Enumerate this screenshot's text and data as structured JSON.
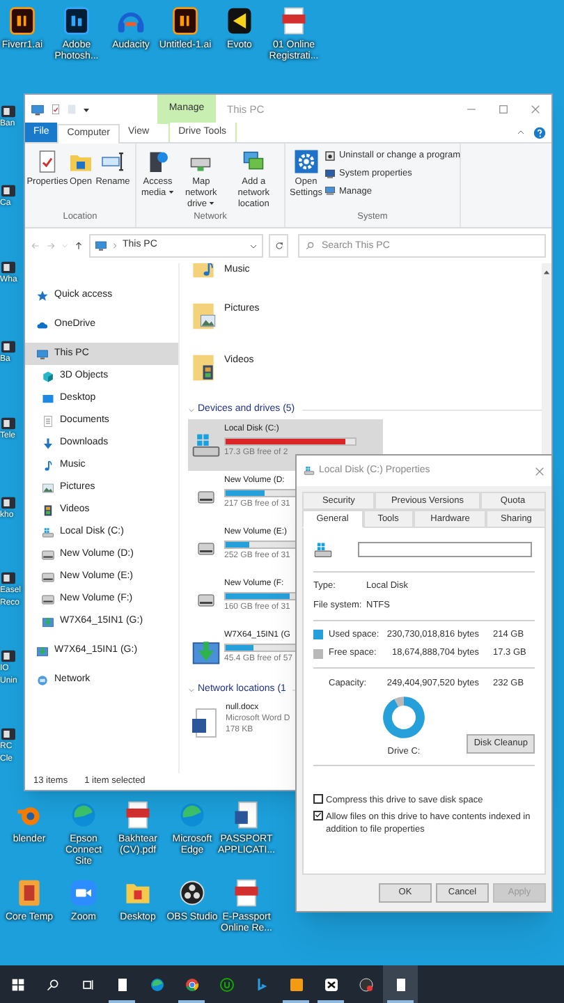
{
  "desktop": {
    "top_row": [
      {
        "label": "Fiverr1.ai",
        "kind": "ai"
      },
      {
        "label": "Adobe Photosh...",
        "kind": "ps"
      },
      {
        "label": "Audacity",
        "kind": "audacity"
      },
      {
        "label": "Untitled-1.ai",
        "kind": "ai"
      },
      {
        "label": "Evoto",
        "kind": "evoto"
      },
      {
        "label": "01 Online Registrati...",
        "kind": "pdf"
      }
    ],
    "left_edge": [
      {
        "label": "Ban"
      },
      {
        "label": "Ca"
      },
      {
        "label": "Wha"
      },
      {
        "label": "Ba"
      },
      {
        "label": "Tele"
      },
      {
        "label": "kho"
      },
      {
        "label": "Easel Reco"
      },
      {
        "label": "IO Unin"
      },
      {
        "label": "RC Cle"
      }
    ],
    "bottom_rows": [
      [
        {
          "label": "blender",
          "kind": "blender"
        },
        {
          "label": "Epson Connect Site",
          "kind": "edge"
        },
        {
          "label": "Bakhtear (CV).pdf",
          "kind": "pdf"
        },
        {
          "label": "Microsoft Edge",
          "kind": "edge"
        },
        {
          "label": "PASSPORT APPLICATI...",
          "kind": "word"
        }
      ],
      [
        {
          "label": "Core Temp",
          "kind": "coretemp"
        },
        {
          "label": "Zoom",
          "kind": "zoom"
        },
        {
          "label": "Desktop",
          "kind": "folder"
        },
        {
          "label": "OBS Studio",
          "kind": "obs"
        },
        {
          "label": "E-Passport Online Re...",
          "kind": "pdf"
        }
      ]
    ]
  },
  "explorer": {
    "title": "This PC",
    "context_tab": "Manage",
    "tabs": [
      {
        "label": "File",
        "kind": "file",
        "selected": false
      },
      {
        "label": "Computer",
        "kind": "tab",
        "selected": true
      },
      {
        "label": "View",
        "kind": "tab",
        "selected": false
      },
      {
        "label": "Drive Tools",
        "kind": "context",
        "selected": false
      }
    ],
    "ribbon": [
      {
        "label": "Location",
        "buttons": [
          {
            "label": "Properties",
            "kind": "properties",
            "dropdown": false
          },
          {
            "label": "Open",
            "kind": "open",
            "dropdown": false
          },
          {
            "label": "Rename",
            "kind": "rename",
            "dropdown": false
          }
        ]
      },
      {
        "label": "Network",
        "buttons": [
          {
            "label": "Access media",
            "kind": "media",
            "dropdown": true
          },
          {
            "label": "Map network drive",
            "kind": "map-drive",
            "dropdown": true
          },
          {
            "label": "Add a network location",
            "kind": "network-location",
            "dropdown": false
          }
        ]
      },
      {
        "label": "System",
        "buttons": [
          {
            "label": "Open Settings",
            "kind": "settings",
            "dropdown": false
          }
        ],
        "small_buttons": [
          {
            "label": "Uninstall or change a program",
            "kind": "uninstall"
          },
          {
            "label": "System properties",
            "kind": "system-properties"
          },
          {
            "label": "Manage",
            "kind": "manage"
          }
        ]
      }
    ],
    "address": {
      "path": "This PC"
    },
    "search": {
      "placeholder": "Search This PC"
    },
    "nav": [
      {
        "label": "Quick access",
        "kind": "star",
        "selected": false
      },
      {
        "label": "OneDrive",
        "kind": "cloud",
        "selected": false
      },
      {
        "label": "This PC",
        "kind": "pc",
        "selected": true,
        "children": [
          {
            "label": "3D Objects",
            "kind": "cube",
            "selected": false
          },
          {
            "label": "Desktop",
            "kind": "desktop",
            "selected": false
          },
          {
            "label": "Documents",
            "kind": "document",
            "selected": false
          },
          {
            "label": "Downloads",
            "kind": "download",
            "selected": false
          },
          {
            "label": "Music",
            "kind": "music",
            "selected": false
          },
          {
            "label": "Pictures",
            "kind": "picture",
            "selected": false
          },
          {
            "label": "Videos",
            "kind": "video",
            "selected": false
          },
          {
            "label": "Local Disk (C:)",
            "kind": "system-drive",
            "selected": false
          },
          {
            "label": "New Volume (D:)",
            "kind": "drive",
            "selected": false
          },
          {
            "label": "New Volume (E:)",
            "kind": "drive",
            "selected": false
          },
          {
            "label": "New Volume (F:)",
            "kind": "drive",
            "selected": false
          },
          {
            "label": "W7X64_15IN1 (G:)",
            "kind": "install-drive",
            "selected": false
          }
        ]
      },
      {
        "label": "W7X64_15IN1 (G:)",
        "kind": "install-drive",
        "selected": false
      },
      {
        "label": "Network",
        "kind": "network",
        "selected": false
      }
    ],
    "folders": [
      {
        "label": "Music",
        "kind": "music"
      },
      {
        "label": "Pictures",
        "kind": "picture"
      },
      {
        "label": "Videos",
        "kind": "video"
      }
    ],
    "drives_header": "Devices and drives (5)",
    "drives": [
      {
        "name": "Local Disk (C:)",
        "free": "17.3 GB free of 2",
        "kind": "system-drive",
        "level": 0.93,
        "low_space": true,
        "selected": true
      },
      {
        "name": "New Volume (D:",
        "free": "217 GB free of 31",
        "kind": "drive",
        "level": 0.3,
        "low_space": false,
        "selected": false
      },
      {
        "name": "New Volume (E:)",
        "free": "252 GB free of 31",
        "kind": "drive",
        "level": 0.18,
        "low_space": false,
        "selected": false
      },
      {
        "name": "New Volume (F:",
        "free": "160 GB free of 31",
        "kind": "drive",
        "level": 0.49,
        "low_space": false,
        "selected": false
      },
      {
        "name": "W7X64_15IN1 (G",
        "free": "45.4 GB free of 57",
        "kind": "install-drive",
        "level": 0.21,
        "low_space": false,
        "selected": false
      }
    ],
    "network_header": "Network locations (1",
    "network_items": [
      {
        "name": "null.docx",
        "type": "Microsoft Word D",
        "size": "178 KB"
      }
    ],
    "status_bar": {
      "count": "13 items",
      "selection": "1 item selected"
    }
  },
  "properties_dialog": {
    "title": "Local Disk (C:) Properties",
    "tabs_back": [
      {
        "label": "Security",
        "selected": false
      },
      {
        "label": "Previous Versions",
        "selected": false
      },
      {
        "label": "Quota",
        "selected": false
      }
    ],
    "tabs_front": [
      {
        "label": "General",
        "selected": true
      },
      {
        "label": "Tools",
        "selected": false
      },
      {
        "label": "Hardware",
        "selected": false
      },
      {
        "label": "Sharing",
        "selected": false
      }
    ],
    "info": [
      {
        "label": "Type:",
        "value": "Local Disk"
      },
      {
        "label": "File system:",
        "value": "NTFS"
      }
    ],
    "space": [
      {
        "label": "Used space:",
        "bytes": "230,730,018,816 bytes",
        "size": "214 GB",
        "color": "#26a0da"
      },
      {
        "label": "Free space:",
        "bytes": "18,674,888,704 bytes",
        "size": "17.3 GB",
        "color": "#b9b9b9"
      }
    ],
    "capacity": {
      "label": "Capacity:",
      "bytes": "249,404,907,520 bytes",
      "size": "232 GB"
    },
    "chart_data": {
      "type": "donut",
      "title": "Drive C:",
      "values": [
        92.5,
        7.5
      ]
    },
    "cleanup_button": "Disk Cleanup",
    "options": [
      {
        "label": "Compress this drive to save disk space",
        "checked": false
      },
      {
        "label": "Allow files on this drive to have contents indexed in addition to file properties",
        "checked": true
      }
    ],
    "buttons": [
      {
        "label": "OK",
        "disabled": false
      },
      {
        "label": "Cancel",
        "disabled": false
      },
      {
        "label": "Apply",
        "disabled": true
      }
    ]
  },
  "taskbar": {
    "apps": [
      {
        "kind": "page",
        "running": true,
        "active": false
      },
      {
        "kind": "edge",
        "running": false,
        "active": false
      },
      {
        "kind": "chrome",
        "running": true,
        "active": false
      },
      {
        "kind": "upwork",
        "running": false,
        "active": false
      },
      {
        "kind": "bing",
        "running": false,
        "active": false
      },
      {
        "kind": "orange",
        "running": true,
        "active": false
      },
      {
        "kind": "capcut",
        "running": true,
        "active": false
      },
      {
        "kind": "obs",
        "running": false,
        "active": false
      },
      {
        "kind": "page",
        "running": true,
        "active": true
      }
    ]
  }
}
